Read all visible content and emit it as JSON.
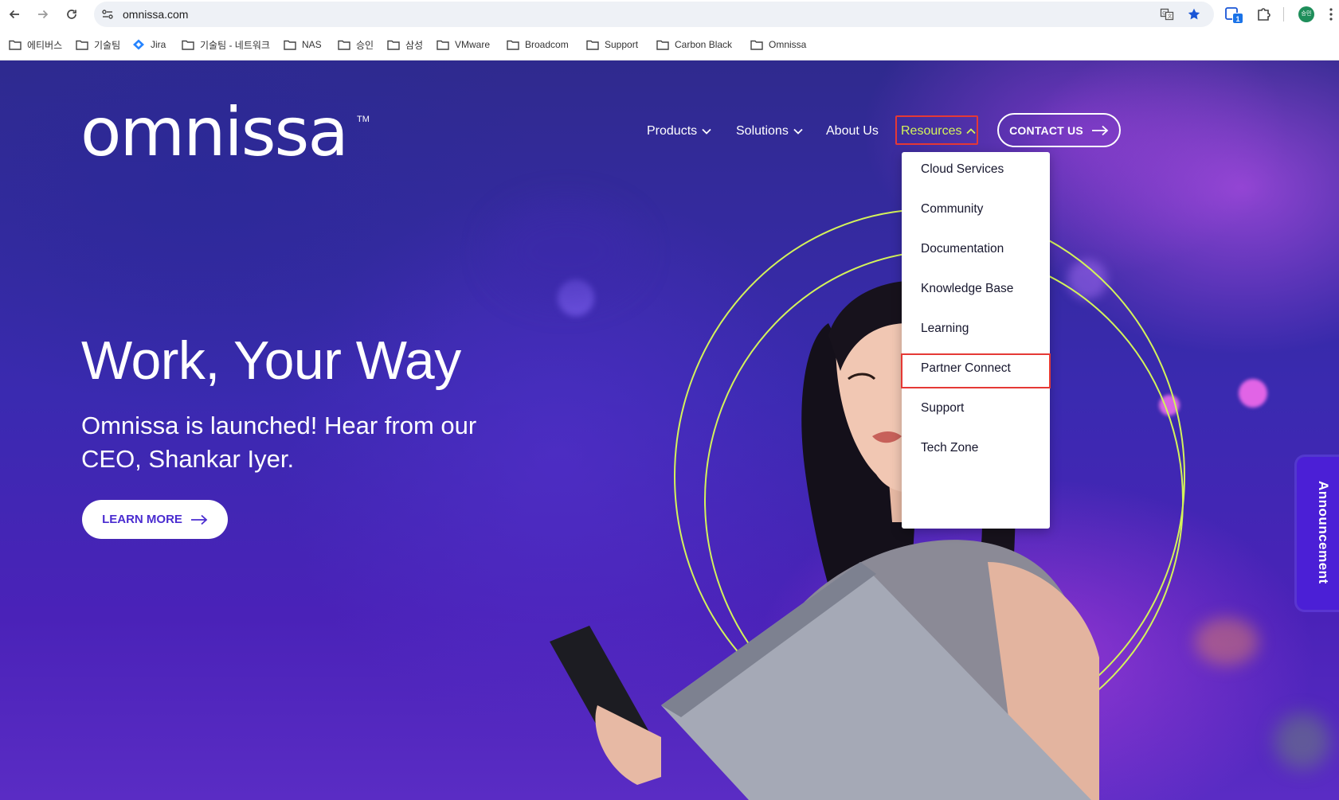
{
  "browser": {
    "url": "omnissa.com",
    "extension_badge": "1",
    "profile_initials": "승민",
    "bookmarks": [
      {
        "label": "에티버스",
        "icon": "folder-icon"
      },
      {
        "label": "기술팀",
        "icon": "folder-icon"
      },
      {
        "label": "Jira",
        "icon": "jira-icon"
      },
      {
        "label": "기술팀 - 네트워크",
        "icon": "folder-icon"
      },
      {
        "label": "NAS",
        "icon": "folder-icon"
      },
      {
        "label": "승인",
        "icon": "folder-icon"
      },
      {
        "label": "삼성",
        "icon": "folder-icon"
      },
      {
        "label": "VMware",
        "icon": "folder-icon"
      },
      {
        "label": "Broadcom",
        "icon": "folder-icon"
      },
      {
        "label": "Support",
        "icon": "folder-icon"
      },
      {
        "label": "Carbon Black",
        "icon": "folder-icon"
      },
      {
        "label": "Omnissa",
        "icon": "folder-icon"
      }
    ]
  },
  "site": {
    "logo": "omnissa",
    "logo_tm": "TM",
    "nav": {
      "products": "Products",
      "solutions": "Solutions",
      "about": "About Us",
      "resources": "Resources",
      "contact": "CONTACT US"
    },
    "resources_menu": [
      "Cloud Services",
      "Community",
      "Documentation",
      "Knowledge Base",
      "Learning",
      "Partner Connect",
      "Support",
      "Tech Zone"
    ],
    "hero": {
      "title": "Work, Your Way",
      "subtitle": "Omnissa is launched! Hear from our CEO, Shankar Iyer.",
      "cta": "LEARN MORE"
    },
    "announcement_tab": "Announcement"
  },
  "colors": {
    "accent_lime": "#d4f35a",
    "brand_purple": "#4b1fd6",
    "highlight_red": "#e53935",
    "cta_text": "#4a2cd0"
  }
}
